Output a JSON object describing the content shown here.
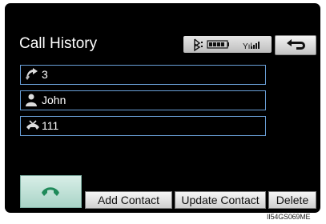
{
  "header": {
    "title": "Call History",
    "back_icon": "return-arrow-icon"
  },
  "status_bar": {
    "icons": [
      "bluetooth-icon",
      "battery-icon",
      "signal-strength-icon"
    ],
    "signal_label": "Yıl"
  },
  "history": {
    "entries": [
      {
        "icon": "outgoing-call-icon",
        "label": "3"
      },
      {
        "icon": "contact-person-icon",
        "label": "John"
      },
      {
        "icon": "missed-call-icon",
        "label": "111"
      }
    ]
  },
  "actions": {
    "call_icon": "phone-handset-icon",
    "add_contact": "Add Contact",
    "update_contact": "Update Contact",
    "delete": "Delete"
  },
  "caption": "II54GS069ME",
  "colors": {
    "screen_bg": "#000000",
    "entry_border": "#6aa0d8",
    "call_button": "#bfe0d6",
    "phone_icon": "#1f8a5a"
  }
}
